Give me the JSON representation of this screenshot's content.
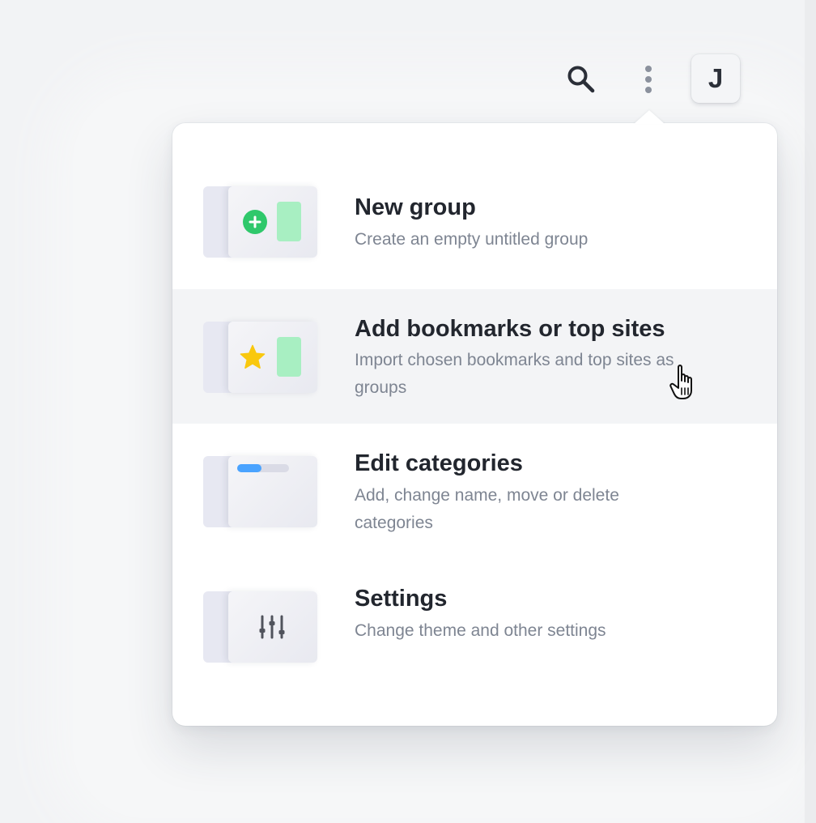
{
  "topbar": {
    "search_icon": "search-icon",
    "more_icon": "more-vertical-icon",
    "avatar_letter": "J"
  },
  "menu": {
    "items": [
      {
        "title": "New group",
        "description": "Create an empty untitled group",
        "icon": "add-circle-icon",
        "accent": "#2fc86b"
      },
      {
        "title": "Add bookmarks or top sites",
        "description": "Import chosen bookmarks and top sites as groups",
        "icon": "star-icon",
        "accent": "#f9c80e",
        "state": "hovered"
      },
      {
        "title": "Edit categories",
        "description": "Add, change name, move or delete categories",
        "icon": "category-bar-icon",
        "accent": "#4aa3ff"
      },
      {
        "title": "Settings",
        "description": "Change theme and other settings",
        "icon": "sliders-icon",
        "accent": "#50535c"
      }
    ]
  },
  "colors": {
    "background": "#f2f3f5",
    "panel": "#ffffff",
    "hover": "#f3f4f6",
    "title_text": "#22262e",
    "description_text": "#7e8592",
    "card_green": "#a8efc2"
  }
}
